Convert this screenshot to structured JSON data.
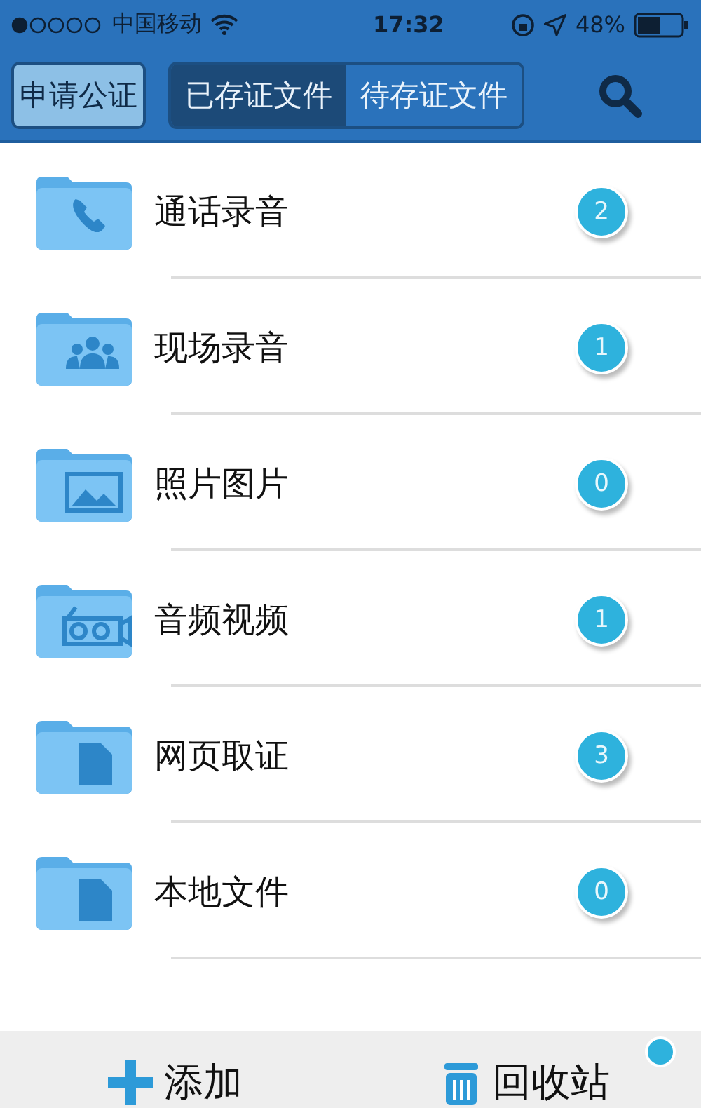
{
  "status_bar": {
    "carrier": "中国移动",
    "time": "17:32",
    "battery": "48%"
  },
  "nav": {
    "apply_button": "申请公证",
    "tabs": [
      {
        "label": "已存证文件",
        "selected": true
      },
      {
        "label": "待存证文件",
        "selected": false
      }
    ]
  },
  "folders": [
    {
      "name": "通话录音",
      "count": "2"
    },
    {
      "name": "现场录音",
      "count": "1"
    },
    {
      "name": "照片图片",
      "count": "0"
    },
    {
      "name": "音频视频",
      "count": "1"
    },
    {
      "name": "网页取证",
      "count": "3"
    },
    {
      "name": "本地文件",
      "count": "0"
    }
  ],
  "toolbar": {
    "add": "添加",
    "recycle": "回收站"
  }
}
